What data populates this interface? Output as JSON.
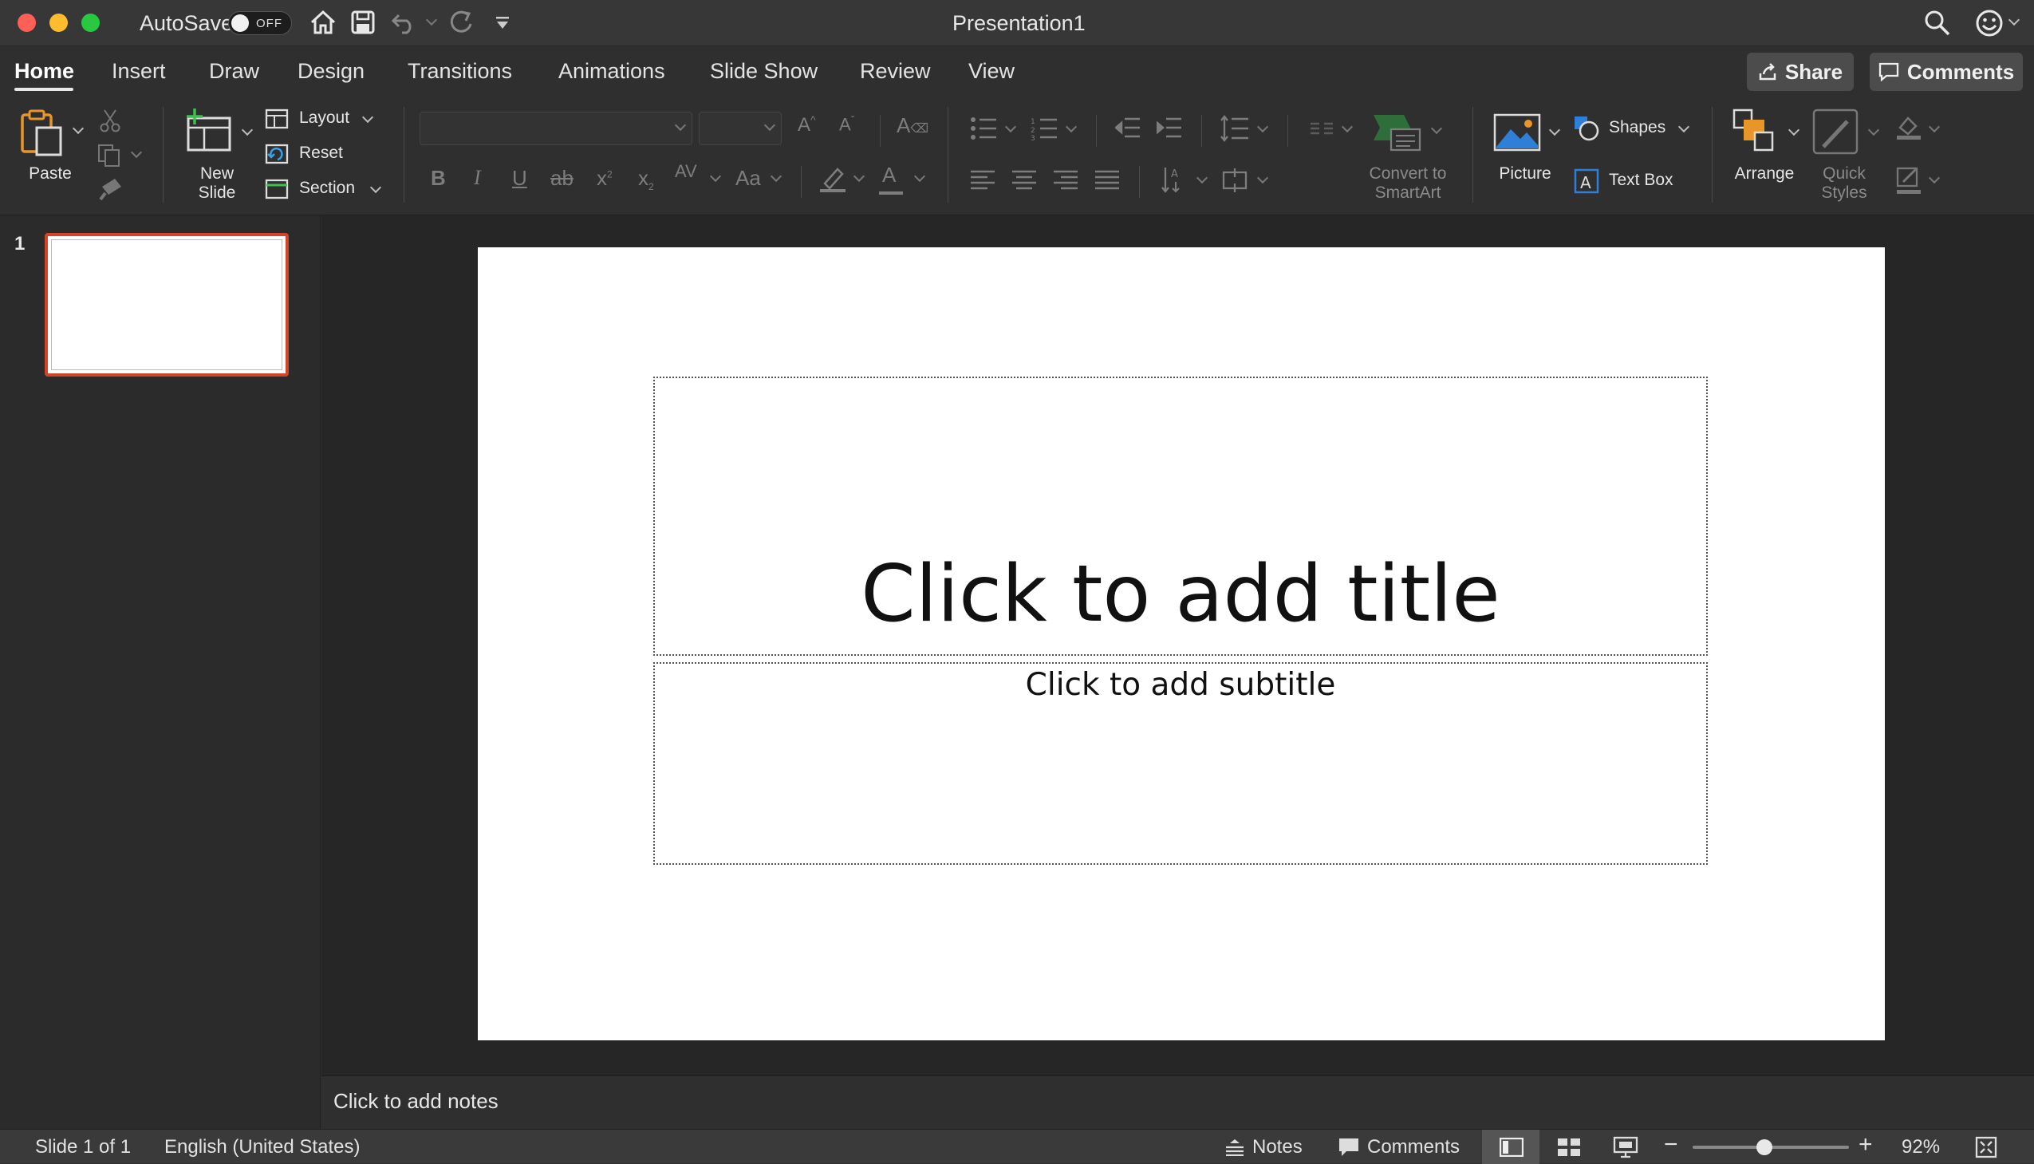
{
  "window": {
    "title": "Presentation1",
    "autosave_label": "AutoSave",
    "autosave_state": "OFF"
  },
  "tabs": [
    {
      "label": "Home",
      "active": true
    },
    {
      "label": "Insert"
    },
    {
      "label": "Draw"
    },
    {
      "label": "Design"
    },
    {
      "label": "Transitions"
    },
    {
      "label": "Animations"
    },
    {
      "label": "Slide Show"
    },
    {
      "label": "Review"
    },
    {
      "label": "View"
    }
  ],
  "topbar": {
    "share_label": "Share",
    "comments_label": "Comments"
  },
  "ribbon": {
    "paste": "Paste",
    "new_slide_1": "New",
    "new_slide_2": "Slide",
    "layout": "Layout",
    "reset": "Reset",
    "section": "Section",
    "font_bold": "B",
    "font_italic": "I",
    "font_underline": "U",
    "font_strike": "ab",
    "font_super": "x",
    "font_sub": "x",
    "char_spacing": "AV",
    "change_case": "Aa",
    "font_color": "A",
    "convert_1": "Convert to",
    "convert_2": "SmartArt",
    "picture": "Picture",
    "shapes": "Shapes",
    "text_box": "Text Box",
    "arrange": "Arrange",
    "quick_1": "Quick",
    "quick_2": "Styles"
  },
  "slides": [
    {
      "number": "1"
    }
  ],
  "slide": {
    "title_placeholder": "Click to add title",
    "subtitle_placeholder": "Click to add subtitle"
  },
  "notes": {
    "placeholder": "Click to add notes"
  },
  "status": {
    "slide_info": "Slide 1 of 1",
    "language": "English (United States)",
    "notes_label": "Notes",
    "comments_label": "Comments",
    "zoom": "92%",
    "zoom_fraction": 0.46
  },
  "colors": {
    "accent": "#d2452b",
    "brand_orange": "#e8952a",
    "brand_blue": "#2f7fd8"
  }
}
